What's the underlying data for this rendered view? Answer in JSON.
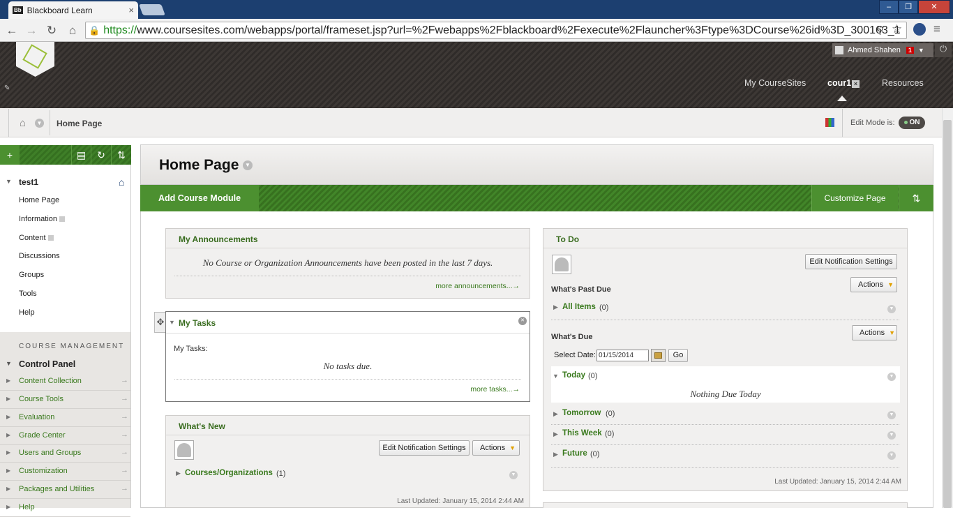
{
  "browser": {
    "tab_title": "Blackboard Learn",
    "tab_icon_text": "Bb",
    "url_https": "https://",
    "url_rest": "www.coursesites.com/webapps/portal/frameset.jsp?url=%2Fwebapps%2Fblackboard%2Fexecute%2Flauncher%3Ftype%3DCourse%26id%3D_300163_1"
  },
  "header": {
    "user_name": "Ahmed Shahen",
    "notification_count": "1",
    "nav_my": "My CourseSites",
    "nav_course": "cour1",
    "nav_resources": "Resources"
  },
  "breadcrumb": {
    "page": "Home Page",
    "edit_mode_label": "Edit Mode is:",
    "edit_mode_value": "ON"
  },
  "sidebar": {
    "course_name": "test1",
    "items": [
      {
        "label": "Home Page"
      },
      {
        "label": "Information"
      },
      {
        "label": "Content"
      },
      {
        "label": "Discussions"
      },
      {
        "label": "Groups"
      },
      {
        "label": "Tools"
      },
      {
        "label": "Help"
      }
    ],
    "course_management": "COURSE MANAGEMENT",
    "control_panel": "Control Panel",
    "cp_items": [
      {
        "label": "Content Collection"
      },
      {
        "label": "Course Tools"
      },
      {
        "label": "Evaluation"
      },
      {
        "label": "Grade Center"
      },
      {
        "label": "Users and Groups"
      },
      {
        "label": "Customization"
      },
      {
        "label": "Packages and Utilities"
      },
      {
        "label": "Help"
      }
    ]
  },
  "page": {
    "title": "Home Page",
    "add_module": "Add Course Module",
    "customize": "Customize Page"
  },
  "announcements": {
    "title": "My Announcements",
    "message": "No Course or Organization Announcements have been posted in the last 7 days.",
    "more": "more announcements...→"
  },
  "tasks": {
    "title": "My Tasks",
    "label": "My Tasks:",
    "message": "No tasks due.",
    "more": "more tasks...→"
  },
  "whatsnew": {
    "title": "What's New",
    "edit_notif": "Edit Notification Settings",
    "actions": "Actions",
    "category": "Courses/Organizations",
    "category_count": "(1)",
    "last_updated": "Last Updated: January 15, 2014 2:44 AM"
  },
  "todo": {
    "title": "To Do",
    "edit_notif": "Edit Notification Settings",
    "past_due_label": "What's Past Due",
    "actions": "Actions",
    "all_items": "All Items",
    "all_items_count": "(0)",
    "due_label": "What's Due",
    "select_date_label": "Select Date:",
    "date_value": "01/15/2014",
    "go": "Go",
    "today": "Today",
    "today_count": "(0)",
    "nothing_today": "Nothing Due Today",
    "tomorrow": "Tomorrow",
    "tomorrow_count": "(0)",
    "this_week": "This Week",
    "this_week_count": "(0)",
    "future": "Future",
    "future_count": "(0)",
    "last_updated": "Last Updated: January 15, 2014 2:44 AM"
  },
  "colors": {
    "brand_green": "#3d7c25",
    "header_dark": "#3a3533",
    "link_green": "#3a7a1e"
  }
}
